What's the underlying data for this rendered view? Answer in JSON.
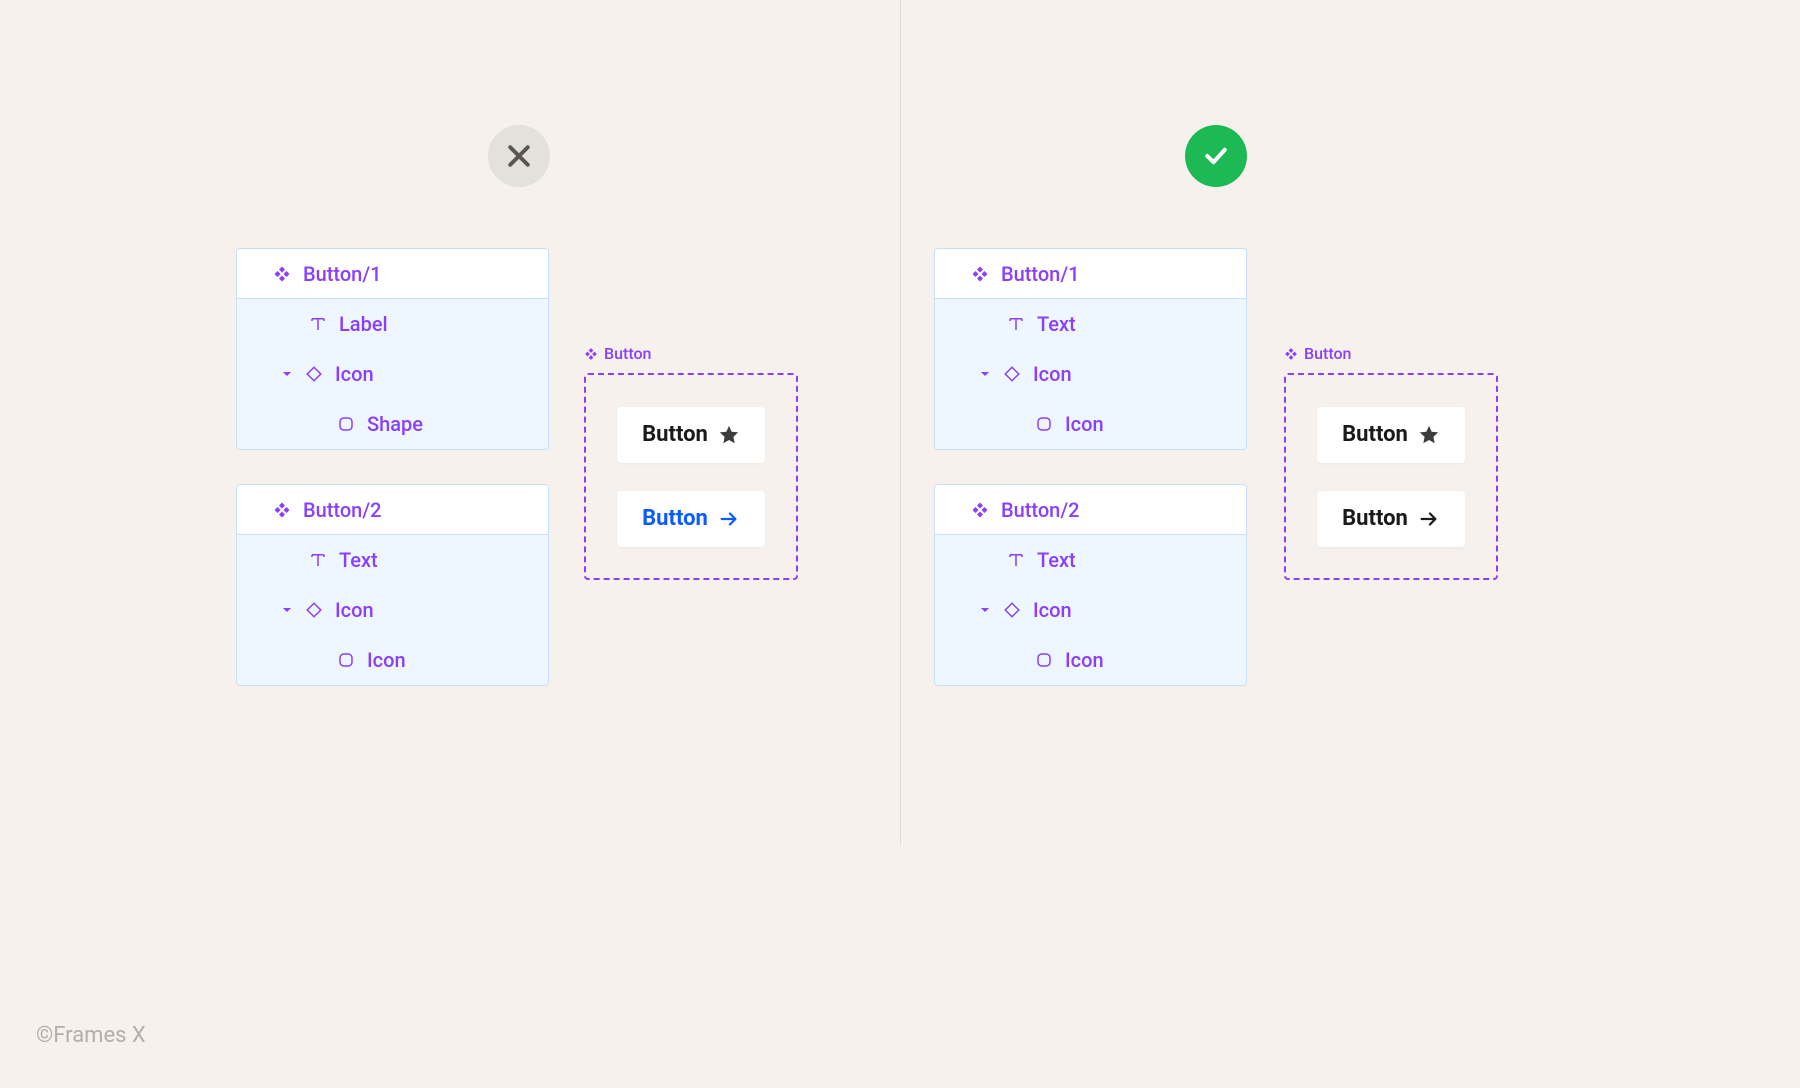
{
  "footer": "©Frames X",
  "badges": {
    "bad_alt": "incorrect",
    "good_alt": "correct"
  },
  "bad": {
    "panels": [
      {
        "title": "Button/1",
        "rows": [
          {
            "kind": "text",
            "label": "Label"
          },
          {
            "kind": "icon-caret",
            "label": "Icon"
          },
          {
            "kind": "shape",
            "label": "Shape"
          }
        ]
      },
      {
        "title": "Button/2",
        "rows": [
          {
            "kind": "text",
            "label": "Text"
          },
          {
            "kind": "icon-caret",
            "label": "Icon"
          },
          {
            "kind": "shape",
            "label": "Icon"
          }
        ]
      }
    ],
    "preview": {
      "label": "Button",
      "variants": [
        {
          "text": "Button",
          "text_color": "black",
          "icon": "star"
        },
        {
          "text": "Button",
          "text_color": "blue",
          "icon": "arrow-blue"
        }
      ]
    }
  },
  "good": {
    "panels": [
      {
        "title": "Button/1",
        "rows": [
          {
            "kind": "text",
            "label": "Text"
          },
          {
            "kind": "icon-caret",
            "label": "Icon"
          },
          {
            "kind": "shape",
            "label": "Icon"
          }
        ]
      },
      {
        "title": "Button/2",
        "rows": [
          {
            "kind": "text",
            "label": "Text"
          },
          {
            "kind": "icon-caret",
            "label": "Icon"
          },
          {
            "kind": "shape",
            "label": "Icon"
          }
        ]
      }
    ],
    "preview": {
      "label": "Button",
      "variants": [
        {
          "text": "Button",
          "text_color": "black",
          "icon": "star"
        },
        {
          "text": "Button",
          "text_color": "black",
          "icon": "arrow-black"
        }
      ]
    }
  }
}
